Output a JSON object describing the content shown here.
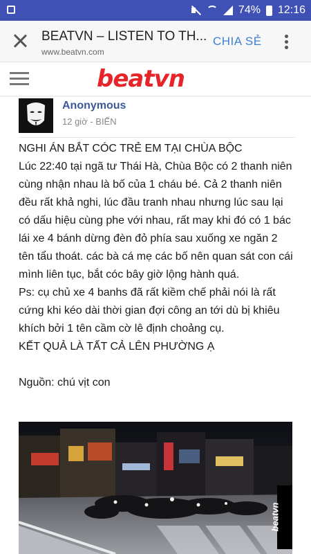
{
  "status_bar": {
    "battery": "74%",
    "time": "12:16"
  },
  "tab": {
    "title": "BEATVN – LISTEN TO TH...",
    "url": "www.beatvn.com",
    "share_label": "CHIA SẺ"
  },
  "site": {
    "logo": "beatvn"
  },
  "post": {
    "author": "Anonymous",
    "meta": "12 giờ - BIẾN",
    "lines": [
      "NGHI ÁN BẮT CÓC TRẺ EM TẠI CHÙA BỘC",
      "Lúc 22:40 tại ngã tư Thái Hà, Chùa Bộc có 2 thanh niên cùng nhận nhau là bố của 1 cháu bé. Cả 2 thanh niên đều rất khả nghi, lúc đầu tranh nhau nhưng lúc sau lại có dấu hiệu cùng phe với nhau, rất may khi đó có 1 bác lái xe 4 bánh dừng đèn đỏ phía sau xuống xe ngăn 2 tên tẩu thoát. các bà cá mẹ các bố nên quan sát con cái mình liên tục, bắt cóc bây giờ lộng hành quá.",
      "Ps: cụ chủ xe 4 banhs đã rất kiềm chế phải nói là rất cứng khi kéo dài thời gian đợi công an tới dù bị khiêu khích bởi 1 tên cầm cờ lê định choảng cụ.",
      "KẾT QUẢ LÀ TẤT CẢ LÊN PHƯỜNG Ạ"
    ],
    "source": "Nguồn: chú vịt con",
    "photo_watermark": "beatvn"
  }
}
